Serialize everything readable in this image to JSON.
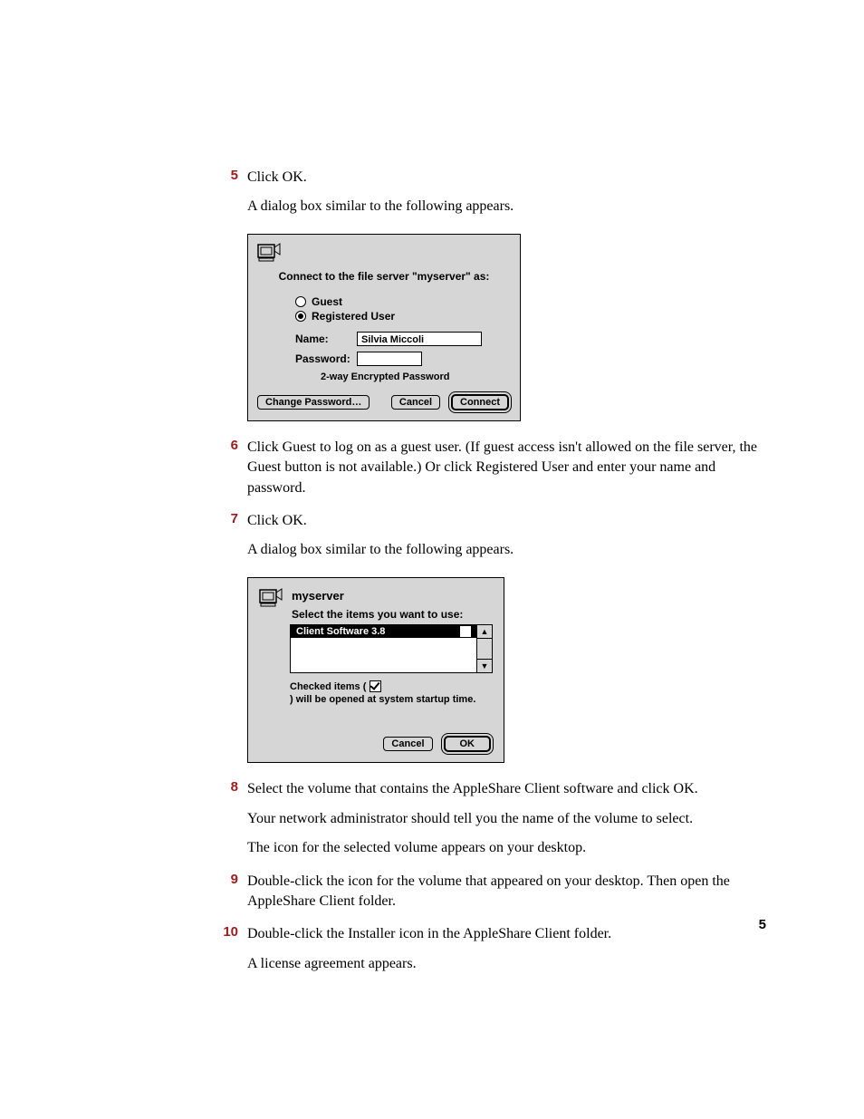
{
  "page_number": "5",
  "steps": [
    {
      "num": "5",
      "lines": [
        "Click OK.",
        "A dialog box similar to the following appears."
      ]
    },
    {
      "num": "6",
      "lines": [
        "Click Guest to log on as a guest user. (If guest access isn't allowed on the file server, the Guest button is not available.) Or click Registered User and enter your name and password."
      ]
    },
    {
      "num": "7",
      "lines": [
        "Click OK.",
        "A dialog box similar to the following appears."
      ]
    },
    {
      "num": "8",
      "lines": [
        "Select the volume that contains the AppleShare Client software and click OK.",
        "Your network administrator should tell you the name of the volume to select.",
        "The icon for the selected volume appears on your desktop."
      ]
    },
    {
      "num": "9",
      "lines": [
        "Double-click the icon for the volume that appeared on your desktop. Then open the AppleShare Client folder."
      ]
    },
    {
      "num": "10",
      "lines": [
        "Double-click the Installer icon in the AppleShare Client folder.",
        "A license agreement appears."
      ]
    }
  ],
  "dialog1": {
    "prompt": "Connect to the file server \"myserver\" as:",
    "guest": "Guest",
    "registered": "Registered User",
    "name_label": "Name:",
    "name_value": "Silvia Miccoli",
    "password_label": "Password:",
    "enc_note": "2-way Encrypted Password",
    "change_pw": "Change Password…",
    "cancel": "Cancel",
    "connect": "Connect"
  },
  "dialog2": {
    "server": "myserver",
    "prompt": "Select the items you want to use:",
    "item": "Client Software 3.8",
    "note_a": "Checked items (",
    "note_b": ") will be opened at system startup time.",
    "cancel": "Cancel",
    "ok": "OK"
  }
}
